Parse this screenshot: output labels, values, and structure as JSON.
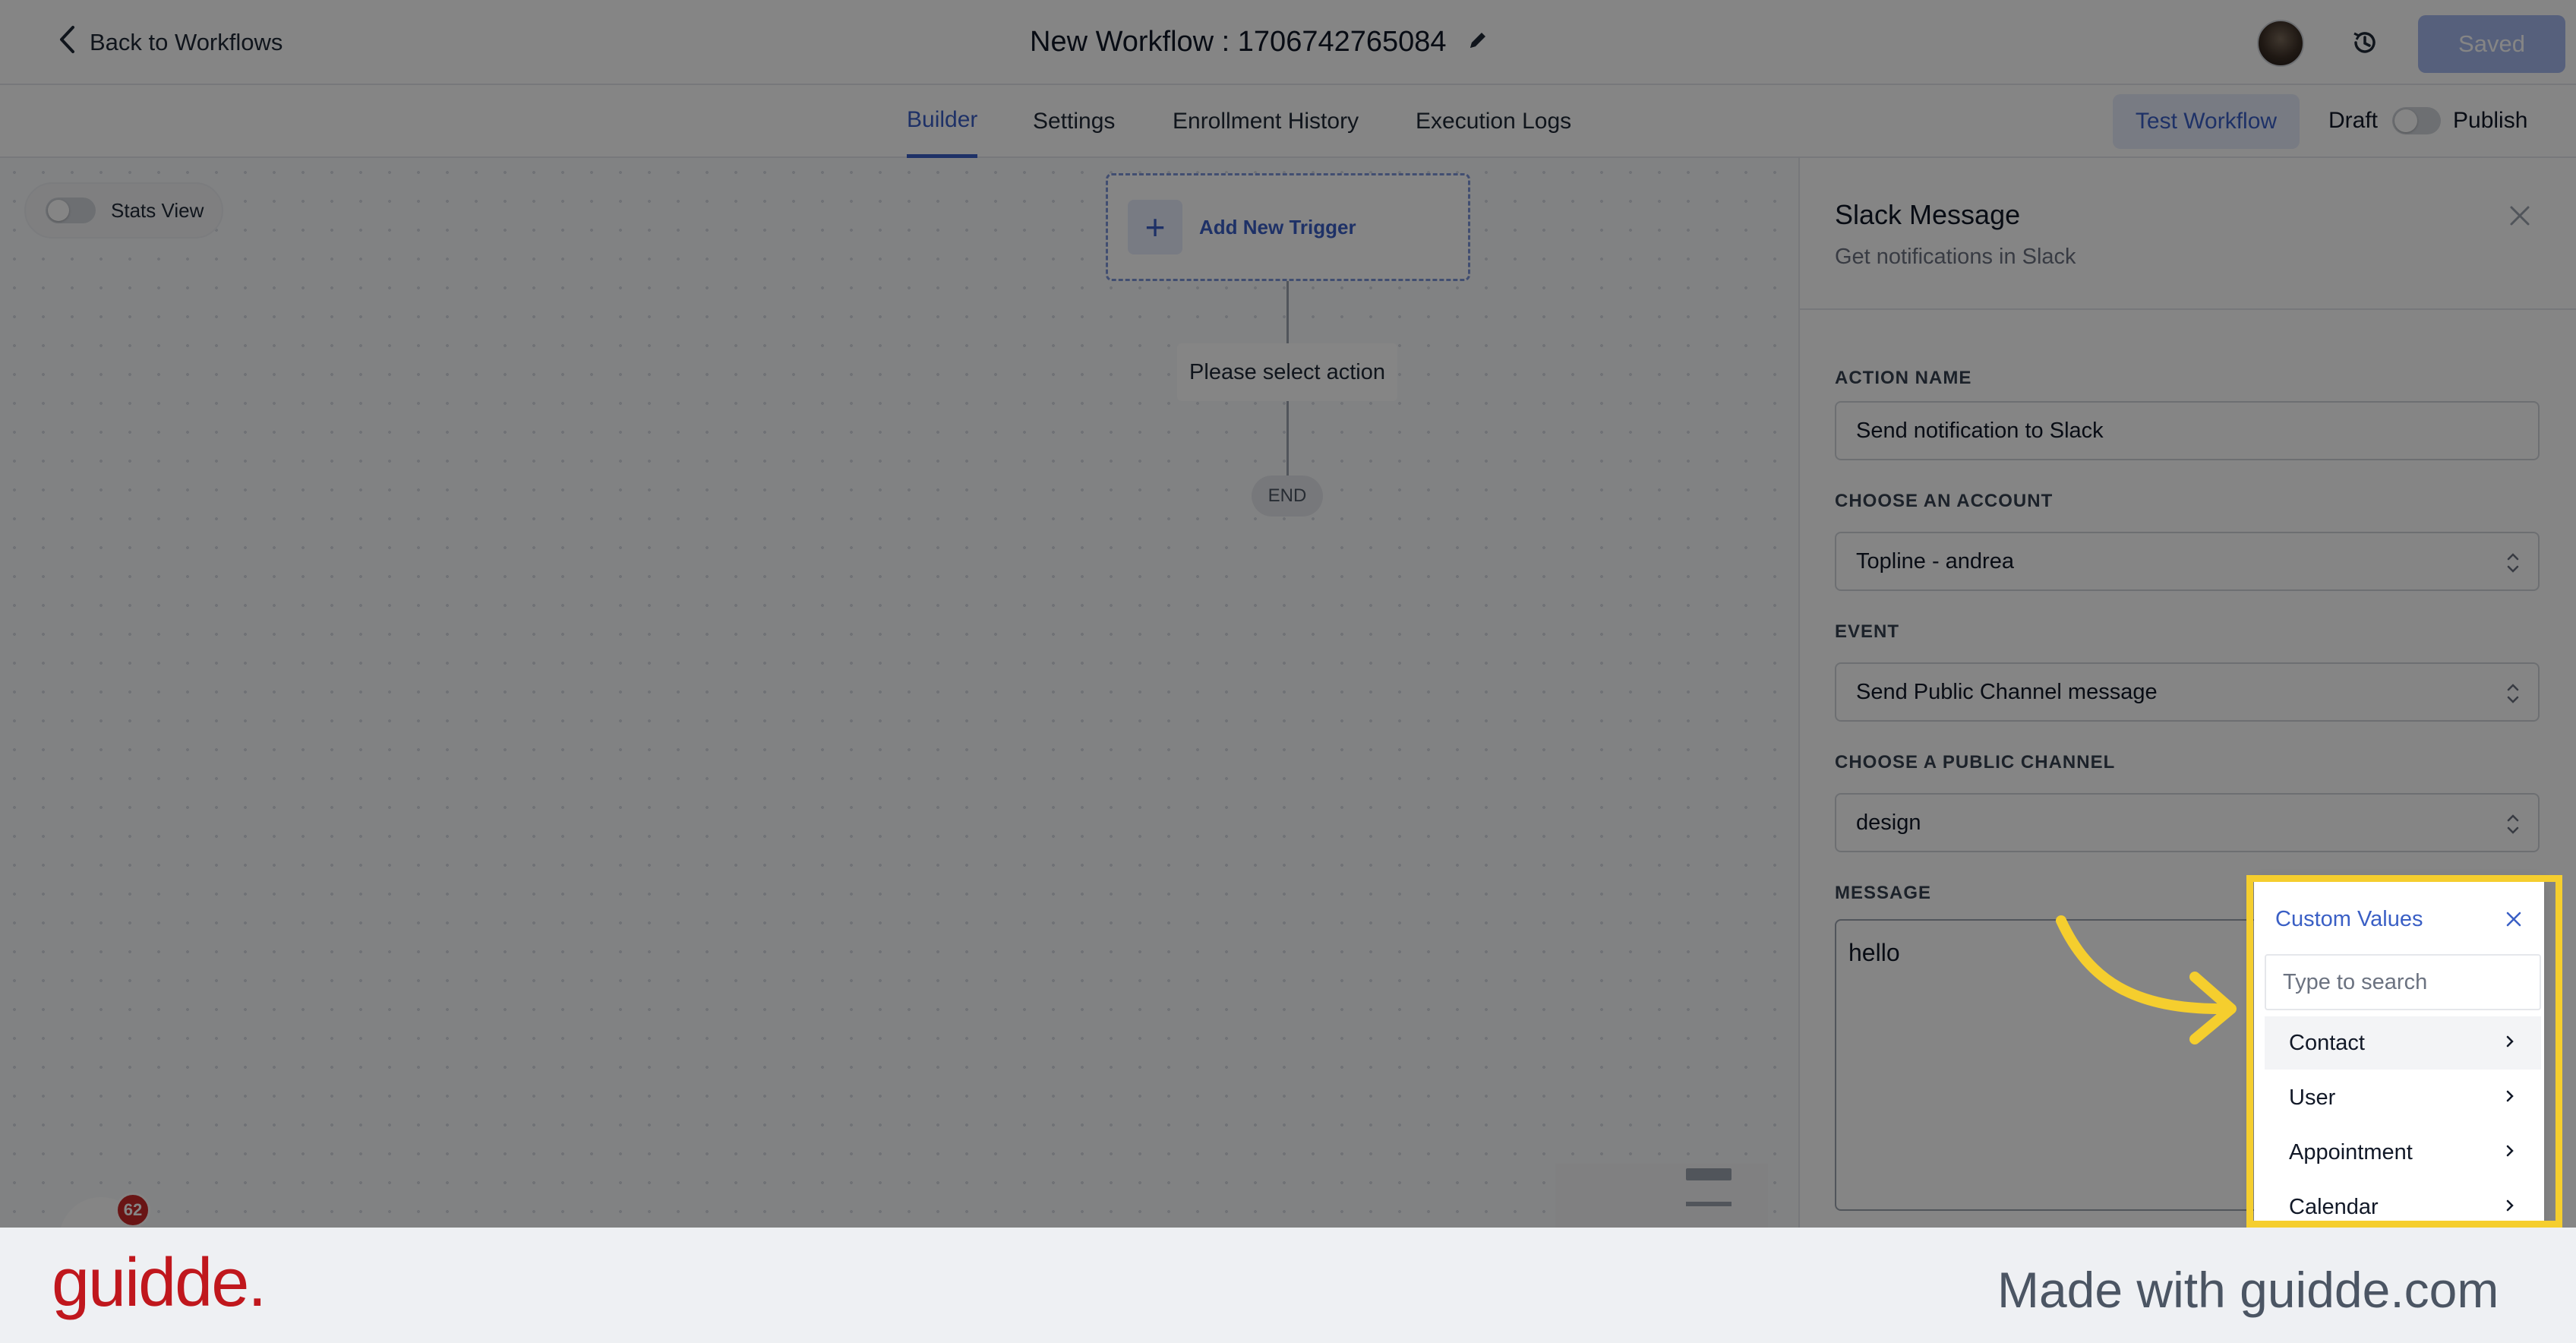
{
  "header": {
    "back_label": "Back to Workflows",
    "title": "New Workflow : 1706742765084",
    "saved_label": "Saved"
  },
  "tabs": [
    {
      "label": "Builder",
      "active": true
    },
    {
      "label": "Settings",
      "active": false
    },
    {
      "label": "Enrollment History",
      "active": false
    },
    {
      "label": "Execution Logs",
      "active": false
    }
  ],
  "actions": {
    "test_workflow": "Test Workflow",
    "draft": "Draft",
    "publish": "Publish"
  },
  "canvas": {
    "stats_view": "Stats View",
    "add_trigger": "Add New Trigger",
    "select_action": "Please select action",
    "end": "END",
    "badge_count": "62"
  },
  "panel": {
    "title": "Slack Message",
    "subtitle": "Get notifications in Slack",
    "fields": {
      "action_name_label": "ACTION NAME",
      "action_name_value": "Send notification to Slack",
      "account_label": "CHOOSE AN ACCOUNT",
      "account_value": "Topline - andrea",
      "event_label": "EVENT",
      "event_value": "Send Public Channel message",
      "channel_label": "CHOOSE A PUBLIC CHANNEL",
      "channel_value": "design",
      "message_label": "MESSAGE",
      "message_value": "hello"
    }
  },
  "custom_values": {
    "title": "Custom Values",
    "search_placeholder": "Type to search",
    "items": [
      "Contact",
      "User",
      "Appointment",
      "Calendar"
    ]
  },
  "footer": {
    "logo": "guidde.",
    "made_with": "Made with guidde.com"
  },
  "colors": {
    "accent": "#3a5fc5",
    "highlight": "#f5ce2e",
    "brand": "#c0171d"
  }
}
